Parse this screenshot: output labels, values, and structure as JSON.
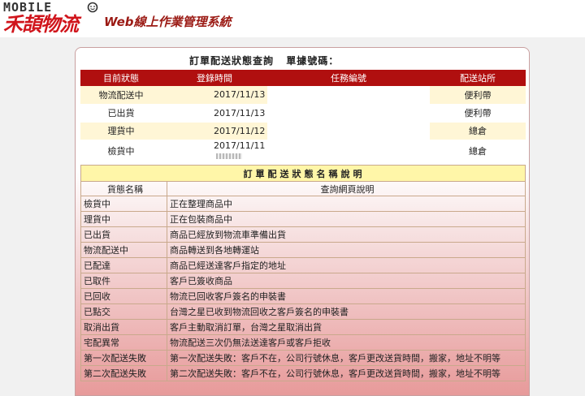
{
  "header": {
    "logo_top": "MOBILE",
    "logo_main": "禾頡物流",
    "system_title": "Web線上作業管理系統"
  },
  "query": {
    "title": "訂單配送狀態查詢",
    "order_label": "單據號碼："
  },
  "status_table": {
    "columns": [
      "目前狀態",
      "登錄時間",
      "任務編號",
      "配送站所"
    ],
    "rows": [
      {
        "status": "物流配送中",
        "time": "2017/11/13",
        "task": "",
        "station": "便利帶"
      },
      {
        "status": "已出貨",
        "time": "2017/11/13",
        "task": "",
        "station": "便利帶"
      },
      {
        "status": "理貨中",
        "time": "2017/11/12",
        "task": "",
        "station": "總倉"
      },
      {
        "status": "檢貨中",
        "time": "2017/11/11",
        "task": "",
        "station": "總倉"
      }
    ]
  },
  "desc_table": {
    "caption": "訂單配送狀態名稱說明",
    "columns": [
      "貨態名稱",
      "查詢網頁說明"
    ],
    "rows": [
      {
        "name": "檢貨中",
        "desc": "正在整理商品中"
      },
      {
        "name": "理貨中",
        "desc": "正在包裝商品中"
      },
      {
        "name": "已出貨",
        "desc": "商品已經放到物流車準備出貨"
      },
      {
        "name": "物流配送中",
        "desc": "商品轉送到各地轉運站"
      },
      {
        "name": "已配達",
        "desc": "商品已經送達客戶指定的地址"
      },
      {
        "name": "已取件",
        "desc": "客戶已簽收商品"
      },
      {
        "name": "已回收",
        "desc": "物流已回收客戶簽名的申裝書"
      },
      {
        "name": "已點交",
        "desc": "台灣之星已收到物流回收之客戶簽名的申裝書"
      },
      {
        "name": "取消出貨",
        "desc": "客戶主動取消訂單，台灣之星取消出貨"
      },
      {
        "name": "宅配異常",
        "desc": "物流配送三次仍無法送達客戶或客戶拒收"
      },
      {
        "name": "第一次配送失敗",
        "desc": "第一次配送失敗：客戶不在，公司行號休息，客戶更改送貨時間，搬家，地址不明等"
      },
      {
        "name": "第二次配送失敗",
        "desc": "第二次配送失敗：客戶不在，公司行號休息，客戶更改送貨時間，搬家，地址不明等"
      }
    ]
  },
  "colors": {
    "brand_red": "#d0141b",
    "header_bar": "#b00f0f",
    "caption_yellow": "#fff6a8"
  }
}
